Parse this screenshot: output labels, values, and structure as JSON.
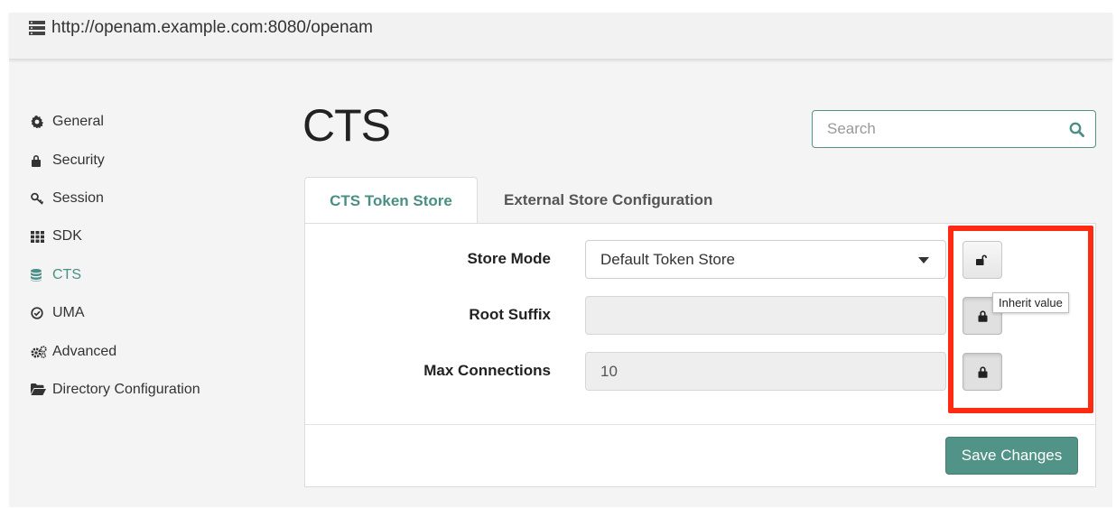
{
  "header": {
    "url": "http://openam.example.com:8080/openam",
    "server_icon": "server-icon"
  },
  "sidebar": {
    "items": [
      {
        "label": "General",
        "icon": "gear-icon",
        "active": false
      },
      {
        "label": "Security",
        "icon": "lock-icon",
        "active": false
      },
      {
        "label": "Session",
        "icon": "key-icon",
        "active": false
      },
      {
        "label": "SDK",
        "icon": "grid-icon",
        "active": false
      },
      {
        "label": "CTS",
        "icon": "database-icon",
        "active": true
      },
      {
        "label": "UMA",
        "icon": "check-circle-icon",
        "active": false
      },
      {
        "label": "Advanced",
        "icon": "gears-icon",
        "active": false
      },
      {
        "label": "Directory Configuration",
        "icon": "folder-open-icon",
        "active": false
      }
    ]
  },
  "main": {
    "title": "CTS",
    "search": {
      "placeholder": "Search",
      "value": ""
    },
    "tabs": [
      {
        "label": "CTS Token Store",
        "active": true
      },
      {
        "label": "External Store Configuration",
        "active": false
      }
    ],
    "fields": [
      {
        "label": "Store Mode",
        "value": "Default Token Store",
        "type": "select",
        "enabled": true,
        "lock": "unlocked"
      },
      {
        "label": "Root Suffix",
        "value": "",
        "type": "text",
        "enabled": false,
        "lock": "locked"
      },
      {
        "label": "Max Connections",
        "value": "10",
        "type": "text",
        "enabled": false,
        "lock": "locked"
      }
    ],
    "tooltip": "Inherit value",
    "save_label": "Save Changes"
  },
  "colors": {
    "accent": "#4a8f85",
    "button": "#519387",
    "highlight": "#ff2a12"
  }
}
